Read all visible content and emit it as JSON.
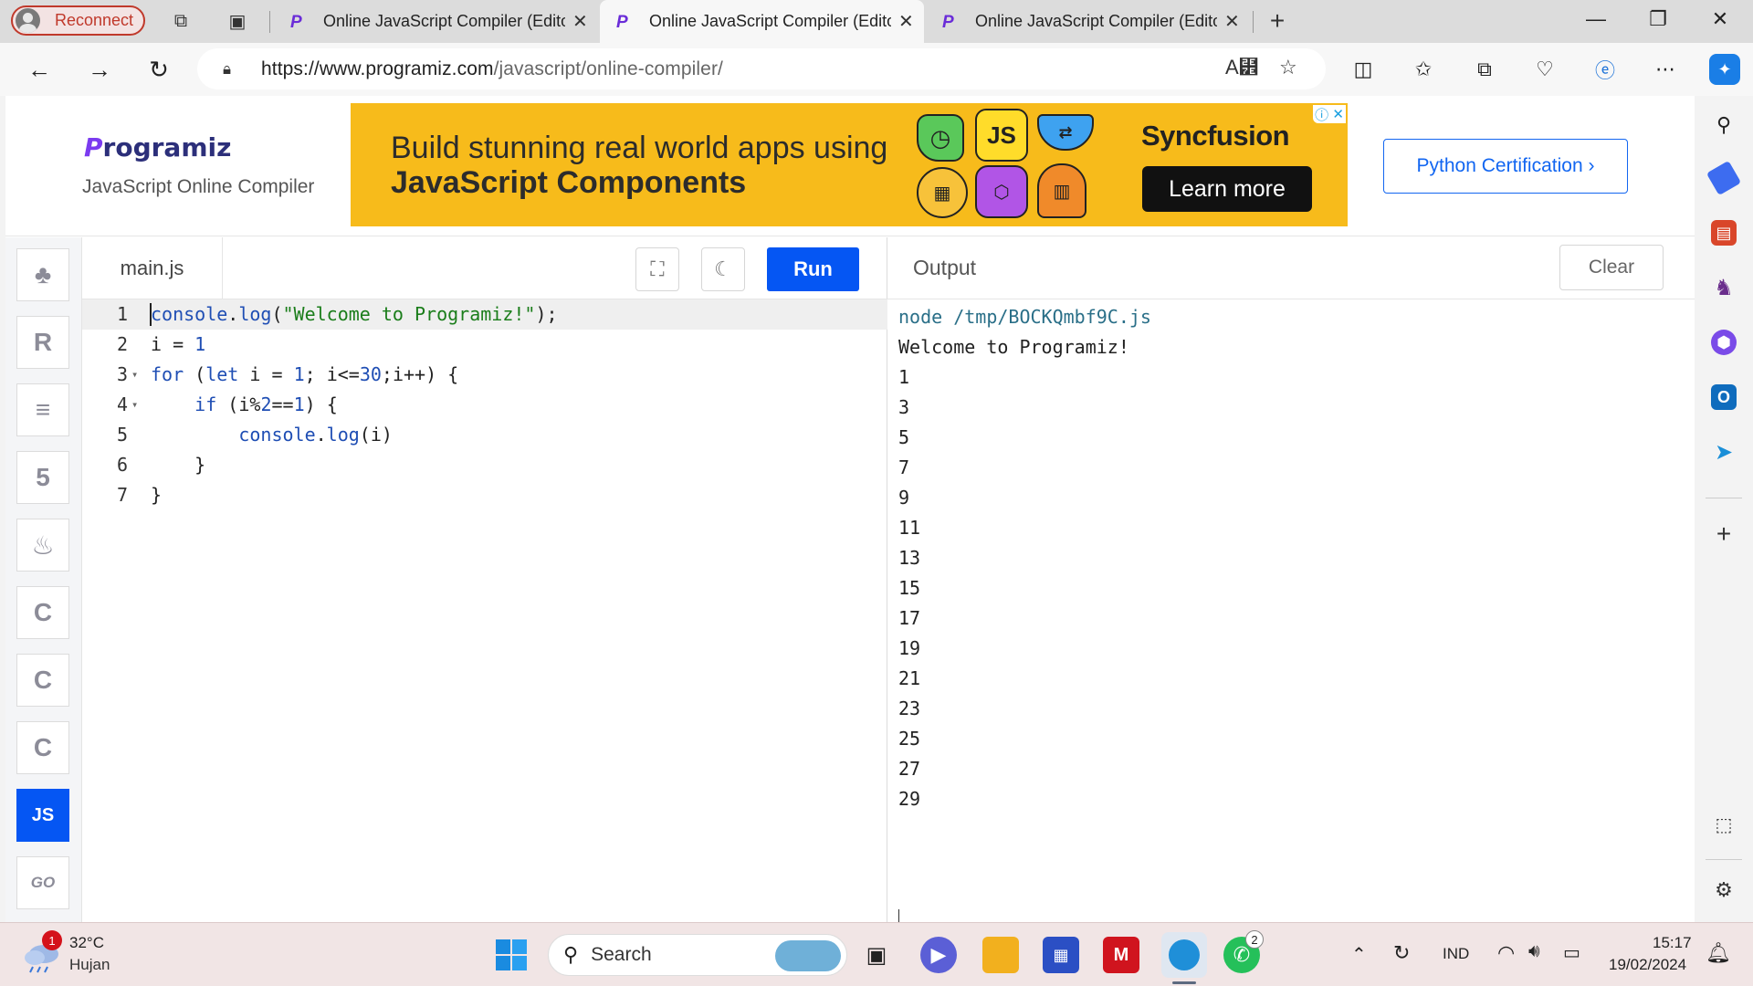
{
  "browser": {
    "profile_label": "Reconnect",
    "tabs": [
      {
        "title": "Online JavaScript Compiler (Editor)"
      },
      {
        "title": "Online JavaScript Compiler (Editor)"
      },
      {
        "title": "Online JavaScript Compiler (Editor)"
      }
    ],
    "url_domain": "https://www.programiz.com",
    "url_path": "/javascript/online-compiler/"
  },
  "header": {
    "logo_p": "P",
    "logo_rest": "rogramiz",
    "subtitle": "JavaScript Online Compiler",
    "certification_button": "Python Certification ›"
  },
  "ad": {
    "line1": "Build stunning real world apps using",
    "line2": "JavaScript Components",
    "js_tile": "JS",
    "brand": "Syncfusion",
    "cta": "Learn more"
  },
  "languages": [
    {
      "name": "python-icon",
      "glyph": "♣"
    },
    {
      "name": "r-icon",
      "glyph": "R"
    },
    {
      "name": "sql-icon",
      "glyph": "≡"
    },
    {
      "name": "html5-icon",
      "glyph": "5"
    },
    {
      "name": "java-icon",
      "glyph": "♨"
    },
    {
      "name": "c-icon",
      "glyph": "C"
    },
    {
      "name": "cpp-icon",
      "glyph": "C"
    },
    {
      "name": "csharp-icon",
      "glyph": "C"
    },
    {
      "name": "javascript-icon",
      "glyph": "JS"
    },
    {
      "name": "go-icon",
      "glyph": "GO"
    }
  ],
  "editor": {
    "file_name": "main.js",
    "run_label": "Run",
    "lines": [
      {
        "n": "1",
        "fold": "",
        "html": "<span class=\"fn\">console</span>.<span class=\"fn\">log</span>(<span class=\"str\">\"Welcome to Programiz!\"</span>);"
      },
      {
        "n": "2",
        "fold": "",
        "html": "i = <span class=\"num\">1</span>"
      },
      {
        "n": "3",
        "fold": "▾",
        "html": "<span class=\"kw\">for</span> (<span class=\"kw\">let</span> i = <span class=\"num\">1</span>; i&lt;=<span class=\"num\">30</span>;i++) {"
      },
      {
        "n": "4",
        "fold": "▾",
        "html": "    <span class=\"kw\">if</span> (i%<span class=\"num\">2</span>==<span class=\"num\">1</span>) {"
      },
      {
        "n": "5",
        "fold": "",
        "html": "        <span class=\"fn\">console</span>.<span class=\"fn\">log</span>(i)"
      },
      {
        "n": "6",
        "fold": "",
        "html": "    }"
      },
      {
        "n": "7",
        "fold": "",
        "html": "}"
      }
    ]
  },
  "output": {
    "title": "Output",
    "clear_label": "Clear",
    "command": "node /tmp/BOCKQmbf9C.js",
    "lines": [
      "Welcome to Programiz!",
      "1",
      "3",
      "5",
      "7",
      "9",
      "11",
      "13",
      "15",
      "17",
      "19",
      "21",
      "23",
      "25",
      "27",
      "29"
    ]
  },
  "taskbar": {
    "weather_badge": "1",
    "temperature": "32°C",
    "condition": "Hujan",
    "search_label": "Search",
    "whatsapp_badge": "2",
    "language": "IND",
    "time": "15:17",
    "date": "19/02/2024"
  }
}
